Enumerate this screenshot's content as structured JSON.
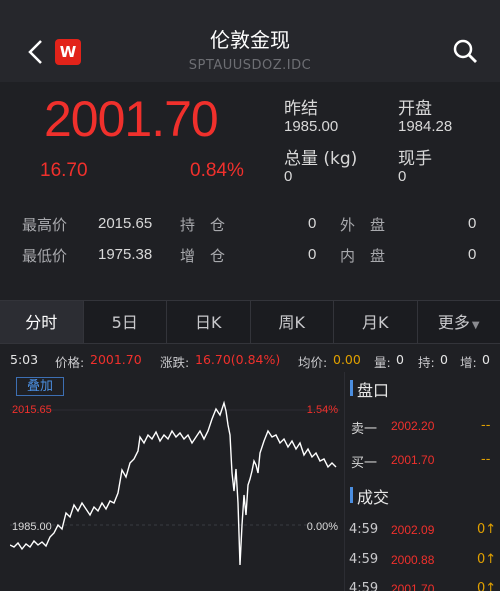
{
  "header": {
    "title": "伦敦金现",
    "subtitle": "SPTAUUSDOZ.IDC",
    "logo_text": "W"
  },
  "quote": {
    "price": "2001.70",
    "change": "16.70",
    "change_pct": "0.84%",
    "prev_close_label": "昨结",
    "prev_close": "1985.00",
    "open_label": "开盘",
    "open": "1984.28",
    "volume_label": "总量 (kg)",
    "volume": "0",
    "hand_label": "现手",
    "hand": "0",
    "high_label": "最高价",
    "high": "2015.65",
    "low_label": "最低价",
    "low": "1975.38",
    "hold_label": "持　仓",
    "hold": "0",
    "add_label": "增　仓",
    "add": "0",
    "outer_label": "外　盘",
    "outer": "0",
    "inner_label": "内　盘",
    "inner": "0"
  },
  "tabs": [
    "分时",
    "5日",
    "日K",
    "周K",
    "月K",
    "更多"
  ],
  "strip": {
    "time": "5:03",
    "price_label": "价格:",
    "price": "2001.70",
    "chg_label": "涨跌:",
    "chg": "16.70(0.84%)",
    "avg_label": "均价:",
    "avg": "0.00",
    "vol_label": "量:",
    "vol": "0",
    "hold_label": "持:",
    "hold": "0",
    "add_label": "增:",
    "add": "0"
  },
  "chart": {
    "overlay_label": "叠加",
    "top_price": "2015.65",
    "top_pct": "1.54%",
    "base_price": "1985.00",
    "base_pct": "0.00%"
  },
  "panel": {
    "orderbook_title": "盘口",
    "sell1_label": "卖一",
    "sell1_price": "2002.20",
    "sell1_qty": "--",
    "buy1_label": "买一",
    "buy1_price": "2001.70",
    "buy1_qty": "--",
    "trades_title": "成交",
    "trades": [
      {
        "time": "4:59",
        "price": "2002.09",
        "qty": "0↑"
      },
      {
        "time": "4:59",
        "price": "2000.88",
        "qty": "0↑"
      },
      {
        "time": "4:59",
        "price": "2001.70",
        "qty": "0↑"
      }
    ]
  },
  "colors": {
    "up": "#f0302c",
    "accent": "#4b8ee0",
    "background": "#1f2024"
  }
}
